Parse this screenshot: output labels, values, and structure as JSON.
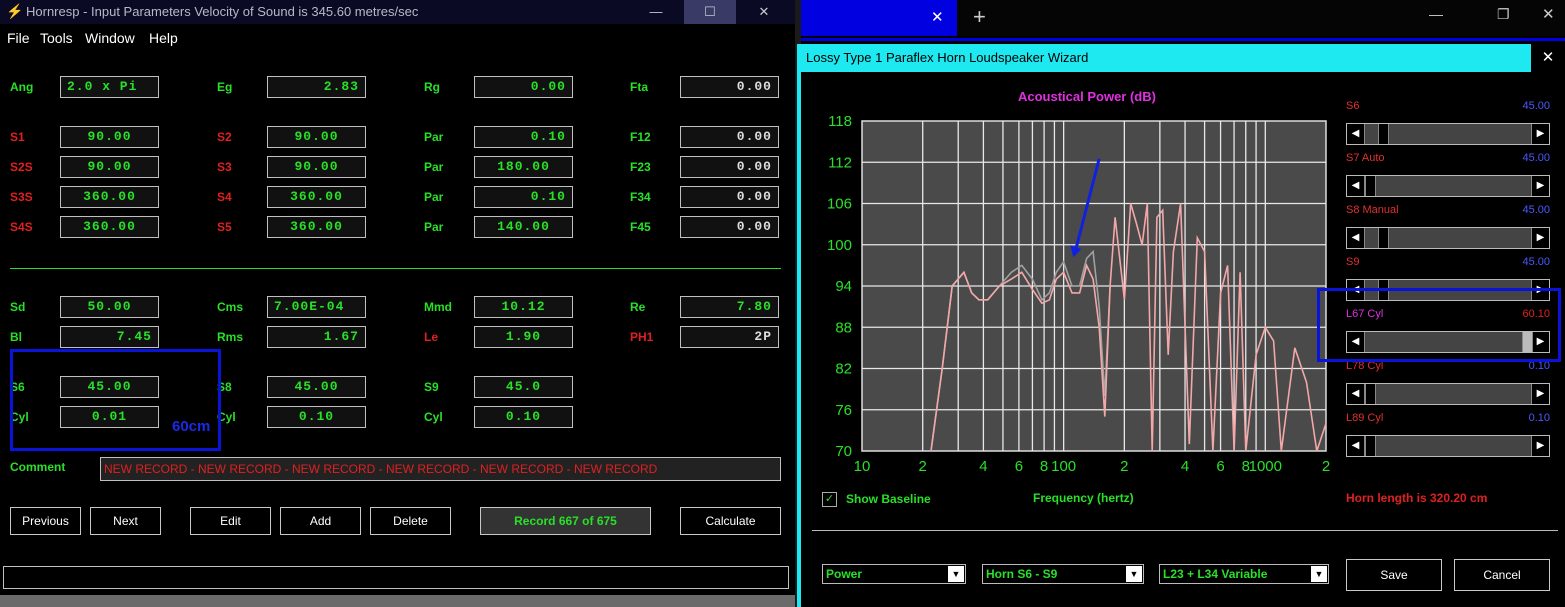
{
  "left_window": {
    "title": "Hornresp - Input Parameters   Velocity of Sound is 345.60 metres/sec",
    "menu": [
      "File",
      "Tools",
      "Window",
      "Help"
    ],
    "params_row1": [
      {
        "label": "Ang",
        "value": "2.0 x Pi"
      },
      {
        "label": "Eg",
        "value": "2.83"
      },
      {
        "label": "Rg",
        "value": "0.00"
      },
      {
        "label": "Fta",
        "value": "0.00"
      }
    ],
    "params_segments": [
      [
        {
          "label": "S1",
          "value": "90.00"
        },
        {
          "label": "S2",
          "value": "90.00"
        },
        {
          "label": "Par",
          "value": "0.10"
        },
        {
          "label": "F12",
          "value": "0.00"
        }
      ],
      [
        {
          "label": "S2S",
          "value": "90.00"
        },
        {
          "label": "S3",
          "value": "90.00"
        },
        {
          "label": "Par",
          "value": "180.00"
        },
        {
          "label": "F23",
          "value": "0.00"
        }
      ],
      [
        {
          "label": "S3S",
          "value": "360.00"
        },
        {
          "label": "S4",
          "value": "360.00"
        },
        {
          "label": "Par",
          "value": "0.10"
        },
        {
          "label": "F34",
          "value": "0.00"
        }
      ],
      [
        {
          "label": "S4S",
          "value": "360.00"
        },
        {
          "label": "S5",
          "value": "360.00"
        },
        {
          "label": "Par",
          "value": "140.00"
        },
        {
          "label": "F45",
          "value": "0.00"
        }
      ]
    ],
    "params_driver": [
      [
        {
          "label": "Sd",
          "value": "50.00"
        },
        {
          "label": "Cms",
          "value": "7.00E-04"
        },
        {
          "label": "Mmd",
          "value": "10.12"
        },
        {
          "label": "Re",
          "value": "7.80"
        }
      ],
      [
        {
          "label": "Bl",
          "value": "7.45"
        },
        {
          "label": "Rms",
          "value": "1.67"
        },
        {
          "label": "Le",
          "value": "1.90"
        },
        {
          "label": "PH1",
          "value": "2P"
        }
      ]
    ],
    "params_extra": [
      [
        {
          "label": "S6",
          "value": "45.00"
        },
        {
          "label": "S8",
          "value": "45.00"
        },
        {
          "label": "S9",
          "value": "45.0"
        }
      ],
      [
        {
          "label": "Cyl",
          "value": "0.01"
        },
        {
          "label": "Cyl",
          "value": "0.10"
        },
        {
          "label": "Cyl",
          "value": "0.10"
        }
      ]
    ],
    "annotation_60cm": "60cm",
    "comment_label": "Comment",
    "comment_value": "NEW RECORD - NEW RECORD - NEW RECORD - NEW RECORD - NEW RECORD - NEW RECORD",
    "buttons": {
      "previous": "Previous",
      "next": "Next",
      "edit": "Edit",
      "add": "Add",
      "delete": "Delete",
      "record": "Record 667 of 675",
      "calculate": "Calculate"
    },
    "colors": {
      "label_green": "#28e028",
      "label_red": "#e02020",
      "highlight_blue": "#0a14d8"
    }
  },
  "right_window": {
    "wizard_title": "Lossy Type 1 Paraflex Horn Loudspeaker Wizard",
    "chart_title": "Acoustical Power (dB)",
    "x_axis_label": "Frequency (hertz)",
    "show_baseline_label": "Show Baseline",
    "show_baseline_checked": true,
    "horn_length": "Horn length is 320.20 cm",
    "sliders": [
      {
        "label": "S6",
        "value": "45.00",
        "fraction": 0.08
      },
      {
        "label": "S7 Auto",
        "value": "45.00",
        "fraction": 0.0
      },
      {
        "label": "S8 Manual",
        "value": "45.00",
        "fraction": 0.08
      },
      {
        "label": "S9",
        "value": "45.00",
        "fraction": 0.08
      },
      {
        "label": "L67 Cyl",
        "value": "60.10",
        "fraction": 1.0
      },
      {
        "label": "L78 Cyl",
        "value": "0.10",
        "fraction": 0.0
      },
      {
        "label": "L89 Cyl",
        "value": "0.10",
        "fraction": 0.0
      }
    ],
    "dropdowns": [
      {
        "name": "power",
        "value": "Power"
      },
      {
        "name": "horn",
        "value": "Horn S6 - S9"
      },
      {
        "name": "variable",
        "value": "L23 + L34 Variable"
      }
    ],
    "save_label": "Save",
    "cancel_label": "Cancel",
    "colors": {
      "title_bar": "#1ee8f0",
      "chart_bg": "#4a4a4a",
      "curve_pink": "#f2a8a8",
      "curve_grey": "#a0a0a0",
      "chart_title_color": "#e030e0",
      "axis_text": "#28e028"
    }
  },
  "chart_data": {
    "type": "line",
    "title": "Acoustical Power (dB)",
    "xlabel": "Frequency (hertz)",
    "ylabel": "",
    "x_scale": "log",
    "xlim": [
      10,
      2000
    ],
    "ylim": [
      70,
      118
    ],
    "x_ticks": [
      "10",
      "2",
      "4",
      "6",
      "8",
      "100",
      "2",
      "4",
      "6",
      "8",
      "1000",
      "2"
    ],
    "y_ticks": [
      "118",
      "112",
      "106",
      "100",
      "94",
      "88",
      "82",
      "76",
      "70"
    ],
    "grid": true,
    "series": [
      {
        "color": "#f2a8a8",
        "x": [
          22,
          25,
          28,
          32,
          35,
          38,
          42,
          48,
          55,
          62,
          70,
          78,
          85,
          92,
          100,
          110,
          120,
          130,
          140,
          150,
          160,
          170,
          180,
          200,
          215,
          230,
          245,
          260,
          275,
          290,
          310,
          330,
          350,
          380,
          420,
          460,
          500,
          550,
          600,
          650,
          700,
          750,
          800,
          900,
          1000,
          1100,
          1200,
          1400,
          1600,
          1800,
          2000
        ],
        "y": [
          70,
          82,
          94,
          96,
          93,
          92,
          92,
          94,
          95,
          96,
          93.5,
          91.5,
          92,
          95,
          96,
          93,
          93,
          97,
          95,
          88,
          75,
          94,
          104,
          92,
          106,
          103,
          100,
          106,
          70,
          104,
          105,
          84,
          99,
          106,
          71,
          101,
          99,
          70,
          93,
          97,
          70,
          96,
          70,
          84,
          88,
          86,
          70,
          85,
          80,
          70,
          74
        ]
      },
      {
        "color": "#a0a0a0",
        "x": [
          22,
          25,
          28,
          32,
          35,
          38,
          42,
          48,
          55,
          62,
          70,
          78,
          85,
          92,
          100,
          110,
          120,
          130,
          140,
          150,
          160,
          170
        ],
        "y": [
          70,
          82,
          94,
          96,
          93,
          92,
          92,
          94,
          96,
          97,
          95,
          92,
          93,
          96,
          97.5,
          94,
          94,
          98,
          99,
          91,
          78,
          94
        ]
      }
    ]
  }
}
